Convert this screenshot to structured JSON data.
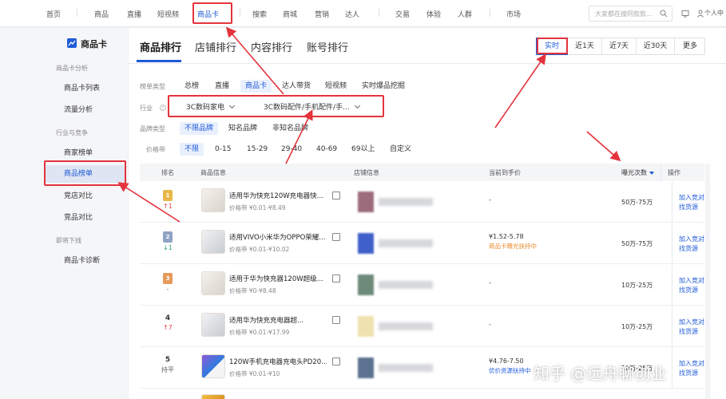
{
  "topnav": {
    "items": [
      "首页",
      "商品",
      "直播",
      "短视频",
      "商品卡",
      "搜索",
      "商城",
      "营销",
      "达人",
      "交易",
      "体验",
      "人群",
      "市场"
    ],
    "search_placeholder": "大家都在搜同款款...",
    "right_text": "个人中"
  },
  "sidebar": {
    "title": "商品卡",
    "groups": [
      {
        "label": "商品卡分析",
        "items": [
          "商品卡列表",
          "流量分析"
        ]
      },
      {
        "label": "行业与竞争",
        "items": [
          "商家榜单",
          "商品榜单",
          "竞店对比",
          "竞品对比"
        ]
      },
      {
        "label": "即将下线",
        "items": [
          "商品卡诊断"
        ]
      }
    ],
    "active_item": "商品榜单"
  },
  "tabs": [
    "商品排行",
    "店铺排行",
    "内容排行",
    "账号排行"
  ],
  "time_filters": [
    "实时",
    "近1天",
    "近7天",
    "近30天",
    "更多"
  ],
  "filters": {
    "list_type_label": "榜单类型",
    "list_types": [
      "总榜",
      "直播",
      "商品卡",
      "达人带货",
      "短视频",
      "实时爆品挖掘"
    ],
    "industry_label": "行业",
    "industry_primary": "3C数码家电",
    "industry_secondary": "3C数码配件/手机配件/手...",
    "brand_label": "品牌类型",
    "brands": [
      "不限品牌",
      "知名品牌",
      "非知名品牌"
    ],
    "price_label": "价格带",
    "prices": [
      "不限",
      "0-15",
      "15-29",
      "29-40",
      "40-69",
      "69以上",
      "自定义"
    ]
  },
  "table": {
    "headers": {
      "rank": "排名",
      "product": "商品信息",
      "store": "店铺信息",
      "price": "当前到手价",
      "exposure": "曝光次数",
      "ops": "操作"
    },
    "rows": [
      {
        "rank": "1",
        "change": "↑1",
        "name": "适用华为快充120W充电器快...",
        "range": "价格带 ¥0.01-¥8.49",
        "price": "-",
        "tag": "",
        "exposure": "50万-75万",
        "op1": "加入竞对",
        "op2": "找货源"
      },
      {
        "rank": "2",
        "change": "↓1",
        "name": "适用VIVO小米华为OPPO荣耀...",
        "range": "价格带 ¥0.01-¥10.02",
        "price": "¥1.52-5.78",
        "tag": "商品卡曝光扶持中",
        "exposure": "50万-75万",
        "op1": "加入竞对",
        "op2": "找货源"
      },
      {
        "rank": "3",
        "change": "-",
        "name": "适用于华为快充器120W超级...",
        "range": "价格带 ¥0-¥8.48",
        "price": "-",
        "tag": "",
        "exposure": "10万-25万",
        "op1": "加入竞对",
        "op2": "找货源"
      },
      {
        "rank": "4",
        "change": "↑7",
        "name": "适用华为快充充电器超...",
        "range": "价格带 ¥0.01-¥17.99",
        "price": "-",
        "tag": "",
        "exposure": "10万-25万",
        "op1": "加入竞对",
        "op2": "找货源"
      },
      {
        "rank": "5",
        "change": "持平",
        "name": "120W手机充电器充电头PD20...",
        "range": "价格带 ¥0.01-¥10",
        "price": "¥4.76-7.50",
        "tag": "优价资源扶持中",
        "exposure": "10万-25万",
        "op1": "加入竞对",
        "op2": "找货源"
      }
    ]
  },
  "watermark": "知乎 @远舟聊创业",
  "colors": {
    "accent": "#1f5ad8",
    "annotation": "#e4333c",
    "up": "#e2434b",
    "down": "#2aa570"
  }
}
